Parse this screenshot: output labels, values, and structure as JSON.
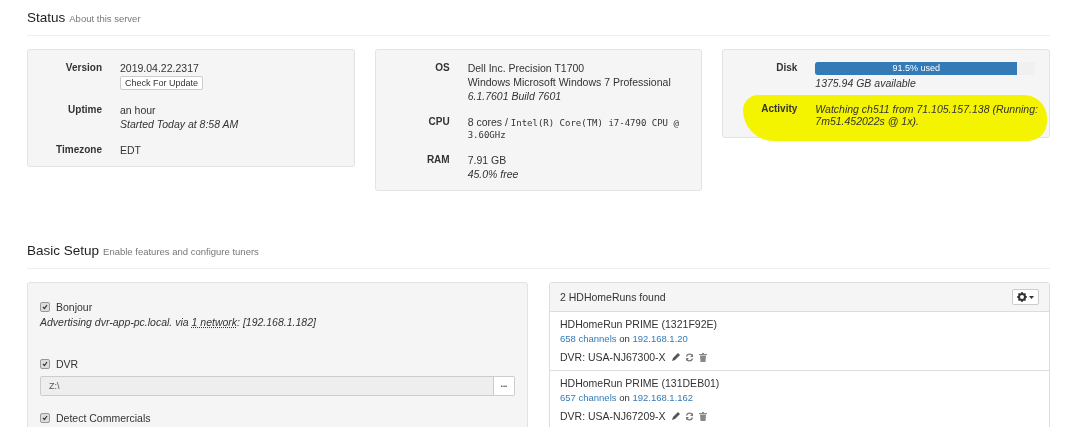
{
  "status": {
    "title": "Status",
    "subtitle": "About this server",
    "cards": [
      {
        "rows": [
          {
            "label": "Version",
            "lines": [
              {
                "kind": "plain",
                "text": "2019.04.22.2317"
              },
              {
                "kind": "button",
                "text": "Check For Update"
              }
            ]
          },
          {
            "label": "Uptime",
            "lines": [
              {
                "kind": "plain",
                "text": "an hour"
              },
              {
                "kind": "italic",
                "text": "Started Today at 8:58 AM"
              }
            ]
          },
          {
            "label": "Timezone",
            "lines": [
              {
                "kind": "plain",
                "text": "EDT"
              }
            ]
          }
        ]
      },
      {
        "rows": [
          {
            "label": "OS",
            "lines": [
              {
                "kind": "plain",
                "text": "Dell Inc. Precision T1700"
              },
              {
                "kind": "plain",
                "text": "Windows Microsoft Windows 7 Professional"
              },
              {
                "kind": "italic",
                "text": "6.1.7601 Build 7601"
              }
            ]
          },
          {
            "label": "CPU",
            "lines": [
              {
                "kind": "cpu",
                "text": "8 cores / ",
                "mono": "Intel(R) Core(TM) i7-4790 CPU @ 3.60GHz"
              }
            ]
          },
          {
            "label": "RAM",
            "lines": [
              {
                "kind": "plain",
                "text": "7.91 GB"
              },
              {
                "kind": "italic",
                "text": "45.0% free"
              }
            ]
          }
        ]
      },
      {
        "rows": [
          {
            "label": "Disk",
            "lines": [
              {
                "kind": "meter",
                "text": "91.5% used",
                "level": 0.915
              },
              {
                "kind": "italic",
                "text": "1375.94 GB available"
              }
            ]
          },
          {
            "label": "Activity",
            "highlighted": true,
            "lines": [
              {
                "kind": "italic",
                "text": "Watching ch511 from 71.105.157.138 (Running: 7m51.452022s @ 1x)."
              }
            ]
          }
        ]
      }
    ]
  },
  "basic_setup": {
    "title": "Basic Setup",
    "subtitle": "Enable features and configure tuners",
    "options": [
      {
        "kind": "checkbox",
        "label": "Bonjour",
        "checked": true,
        "note": "Advertising dvr-app-pc.local. via ",
        "note_link": "1 network",
        "note_after": ": [192.168.1.182]"
      },
      {
        "kind": "checkbox",
        "label": "DVR",
        "checked": true
      },
      {
        "kind": "path",
        "value": "Z:\\",
        "button": "•••"
      },
      {
        "kind": "checkbox",
        "label": "Detect Commercials",
        "checked": true
      }
    ],
    "tuners": {
      "header": "2 HDHomeRuns found",
      "devices": [
        {
          "name": "HDHomeRun PRIME (1321F92E)",
          "channels": "658 channels",
          "on": "on",
          "ip": "192.168.1.20",
          "dvr": "DVR: USA-NJ67300-X"
        },
        {
          "name": "HDHomeRun PRIME (131DEB01)",
          "channels": "657 channels",
          "on": "on",
          "ip": "192.168.1.162",
          "dvr": "DVR: USA-NJ67209-X"
        }
      ]
    }
  }
}
